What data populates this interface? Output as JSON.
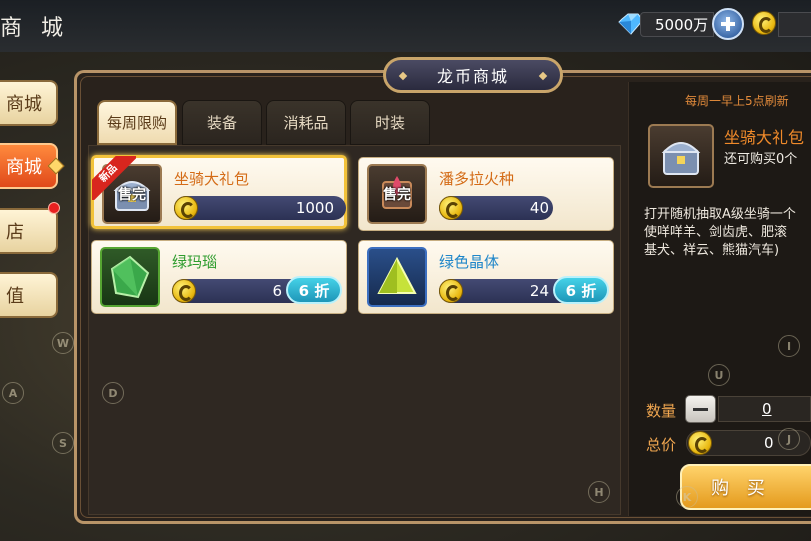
{
  "topbar": {
    "title": "商 城",
    "diamond_amount": "5000万",
    "diamond_icon": "blue-diamond-icon",
    "coin_icon": "dragon-coin-icon"
  },
  "sidebar": {
    "items": [
      {
        "label": "商城",
        "active": false
      },
      {
        "label": "商城",
        "active": true
      },
      {
        "label": "店",
        "active": false,
        "has_notification": true
      },
      {
        "label": "值",
        "active": false
      }
    ]
  },
  "panel": {
    "title": "龙币商城",
    "tabs": [
      {
        "label": "每周限购",
        "active": true
      },
      {
        "label": "装备",
        "active": false
      },
      {
        "label": "消耗品",
        "active": false
      },
      {
        "label": "时装",
        "active": false
      }
    ]
  },
  "items": [
    {
      "name": "坐骑大礼包",
      "price": "1000",
      "status": "售完",
      "badge": "新品",
      "selected": true,
      "icon": "treasure-chest-icon",
      "color": "#d46b16"
    },
    {
      "name": "潘多拉火种",
      "price": "40",
      "status": "售完",
      "icon": "pandora-flame-icon",
      "color": "#d46b16"
    },
    {
      "name": "绿玛瑙",
      "price": "6",
      "discount": "6 折",
      "icon": "green-agate-icon",
      "color": "#2e9c2e"
    },
    {
      "name": "绿色晶体",
      "price": "24",
      "discount": "6 折",
      "icon": "green-crystal-icon",
      "color": "#1f86c9"
    }
  ],
  "detail": {
    "refresh_note": "每周一早上5点刷新",
    "name": "坐骑大礼包",
    "remaining": "还可购买0个",
    "description": "打开随机抽取A级坐骑一个\n使咩咩羊、剑齿虎、肥滚\n基犬、祥云、熊猫汽车)",
    "quantity_label": "数量",
    "quantity": "0",
    "total_label": "总价",
    "total": "0",
    "buy_label": "购 买"
  },
  "key_hints": [
    "W",
    "A",
    "S",
    "D",
    "H",
    "I",
    "U",
    "J",
    "K"
  ]
}
